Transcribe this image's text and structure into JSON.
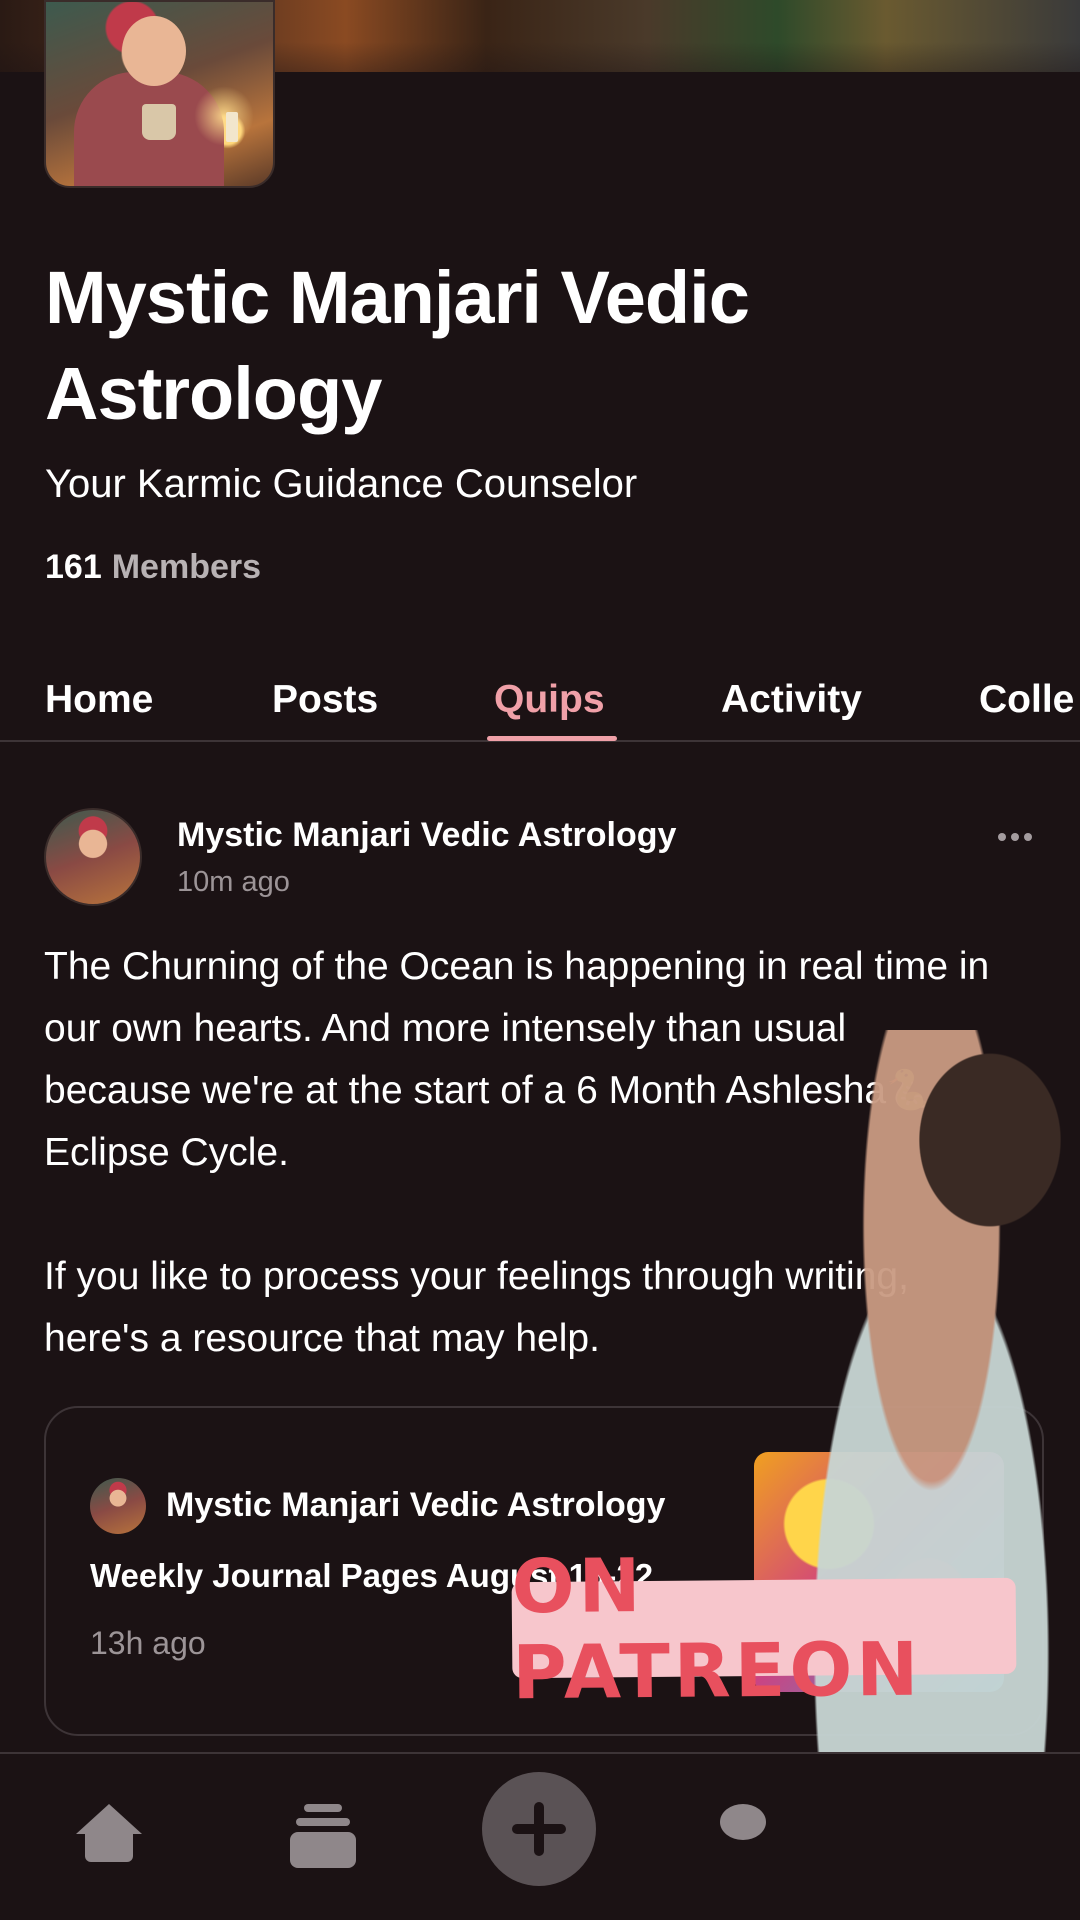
{
  "creator": {
    "name": "Mystic Manjari Vedic Astrology",
    "tagline": "Your Karmic Guidance Counselor",
    "member_count": "161",
    "member_label": "Members"
  },
  "tabs": [
    {
      "label": "Home"
    },
    {
      "label": "Posts"
    },
    {
      "label": "Quips",
      "active": true
    },
    {
      "label": "Activity"
    },
    {
      "label": "Colle"
    }
  ],
  "post": {
    "author": "Mystic Manjari Vedic Astrology",
    "time": "10m ago",
    "paragraph1_a": "The Churning of the Ocean is happening in real time in our own hearts. And more intensely than usual because we're at the start of a 6 Month Ashlesha",
    "emoji": "🐍",
    "paragraph1_b": " Eclipse Cycle.",
    "paragraph2": "If you like to process your feelings through writing, here's a resource that may help."
  },
  "embed": {
    "author": "Mystic Manjari Vedic Astrology",
    "title": "Weekly Journal Pages August 16-22",
    "time": "13h ago"
  },
  "overlay": {
    "sticker_text": "ON PATREON",
    "sticker_color": "#e8505e",
    "sticker_bg": "#f7c6cc"
  },
  "nav": {
    "items": [
      "home-icon",
      "library-icon",
      "add-icon",
      "chat-icon"
    ]
  },
  "colors": {
    "background": "#1b1214",
    "accent": "#f0a0a8",
    "muted": "#9c9497"
  }
}
